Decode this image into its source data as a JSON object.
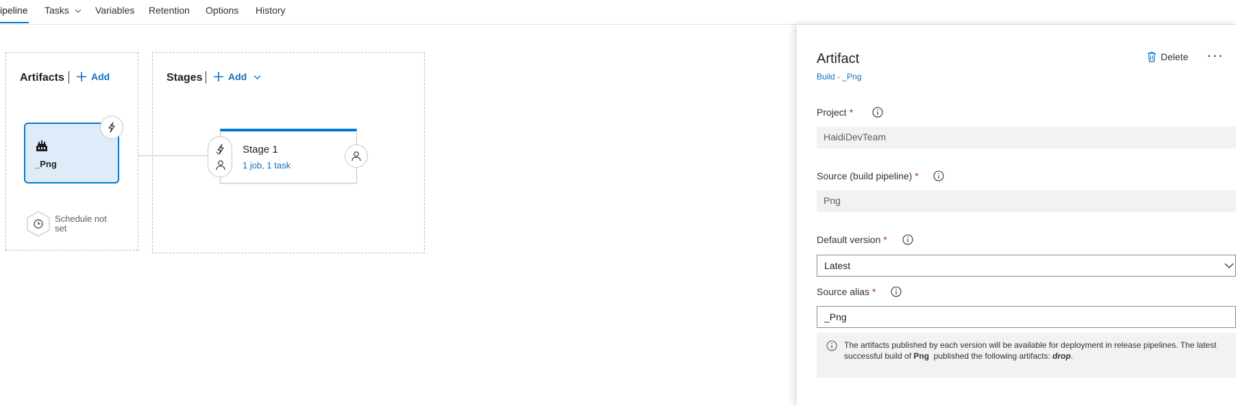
{
  "topnav": {
    "tabs": [
      {
        "label": "ipeline"
      },
      {
        "label": "Tasks"
      },
      {
        "label": "Variables"
      },
      {
        "label": "Retention"
      },
      {
        "label": "Options"
      },
      {
        "label": "History"
      }
    ]
  },
  "canvas": {
    "artifacts": {
      "title": "Artifacts",
      "add_label": "Add",
      "card_name": "_Png",
      "schedule_text": "Schedule not set"
    },
    "stages": {
      "title": "Stages",
      "add_label": "Add",
      "stage_name": "Stage 1",
      "stage_summary": "1 job, 1 task"
    }
  },
  "panel": {
    "title": "Artifact",
    "subtitle": "Build - _Png",
    "delete_label": "Delete",
    "more_label": "···",
    "fields": {
      "project": {
        "label": "Project",
        "required": "*",
        "value": "HaidiDevTeam"
      },
      "source": {
        "label": "Source (build pipeline)",
        "required": "*",
        "value": "Png"
      },
      "default_version": {
        "label": "Default version",
        "required": "*",
        "value": "Latest"
      },
      "source_alias": {
        "label": "Source alias",
        "required": "*",
        "value": "_Png"
      }
    },
    "note": {
      "text_1": "The artifacts published by each version will be available for deployment in release pipelines. The latest successful build of ",
      "bold": "Png",
      "text_2": "  published the following artifacts: ",
      "artifact": "drop",
      "text_3": "."
    }
  },
  "colors": {
    "accent": "#0078d4",
    "link": "#106ebe",
    "required": "#a4262c",
    "selected_card_bg": "#deecf9"
  }
}
